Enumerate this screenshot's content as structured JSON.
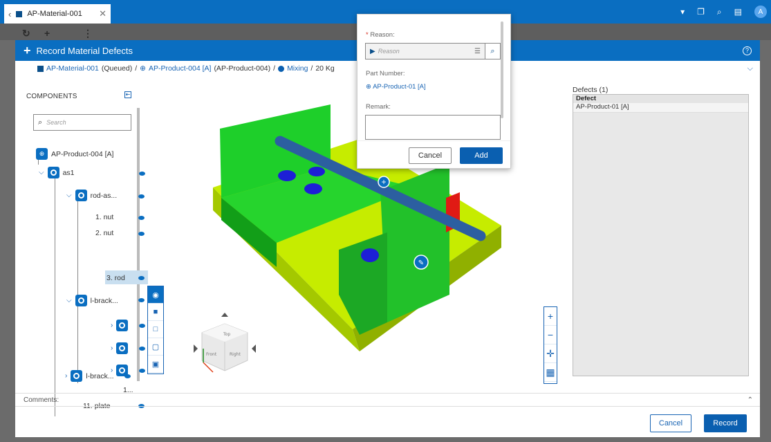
{
  "tab": {
    "title": "AP-Material-001",
    "back_icon": "chevron-left-icon",
    "close_icon": "close-icon"
  },
  "topbar_icons": [
    "dropdown-icon",
    "scan-icon",
    "search-icon",
    "chat-icon"
  ],
  "avatar_initial": "A",
  "modal": {
    "title": "Record Material Defects",
    "breadcrumb": {
      "material": "AP-Material-001",
      "material_status": "(Queued)",
      "separator": "/",
      "product": "AP-Product-004 [A]",
      "product_paren": "(AP-Product-004)",
      "operation": "Mixing",
      "quantity": "20 Kg"
    }
  },
  "components": {
    "header": "COMPONENTS",
    "search_placeholder": "Search",
    "root": "AP-Product-004 [A]",
    "nodes": {
      "as1": "as1",
      "rod_as": "rod-as...",
      "nut1": "1. nut",
      "nut2": "2. nut",
      "rod": "3. rod",
      "lbrack1": "l-brack...",
      "item_1": "1...",
      "plate": "11. plate",
      "lbrack2": "l-brack..."
    }
  },
  "defects": {
    "title": "Defects (1)",
    "column": "Defect",
    "rows": [
      "AP-Product-01 [A]"
    ]
  },
  "popover": {
    "reason_label": "Reason:",
    "reason_required_mark": "*",
    "reason_placeholder": "Reason",
    "part_number_label": "Part Number:",
    "part_number_value": "AP-Product-01 [A]",
    "remark_label": "Remark:",
    "cancel": "Cancel",
    "add": "Add"
  },
  "comments_label": "Comments:",
  "footer": {
    "cancel": "Cancel",
    "record": "Record"
  },
  "colors": {
    "primary": "#0a6ec1",
    "part_green": "#22c12a",
    "plate_yellow": "#b8e000",
    "washer_blue": "#1d1fd6",
    "rod_blue": "#2c5fa0",
    "stop_red": "#e01a14"
  }
}
